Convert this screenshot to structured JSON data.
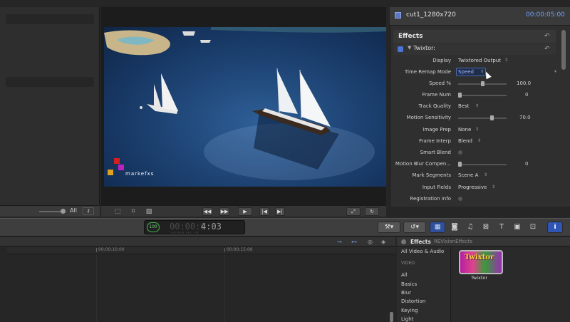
{
  "left_browser": {
    "filter_label": "All",
    "button_icon": "key-icon"
  },
  "viewer": {
    "logo_text": "markefxs",
    "footer_icons": [
      "crop-icon",
      "transform-icon",
      "distort-icon",
      "prev-frame-icon",
      "next-frame-icon",
      "play-icon",
      "to-start-icon",
      "to-end-icon",
      "fullscreen-icon",
      "loop-icon"
    ]
  },
  "inspector": {
    "clip_name": "cut1_1280x720",
    "timecode": "00:00:05:00",
    "section_title": "Effects",
    "effect_name": "Twixtor:",
    "params": [
      {
        "label": "Display",
        "value": "Twixtored Output"
      },
      {
        "label": "Time Remap Mode",
        "value": "Speed"
      },
      {
        "label": "Speed %",
        "number": "100.0",
        "level": 0.5
      },
      {
        "label": "Frame Num",
        "number": "0",
        "level": 0.0
      },
      {
        "label": "Track Quality",
        "value": "Best"
      },
      {
        "label": "Motion Sensitivity",
        "number": "70.0",
        "level": 0.7
      },
      {
        "label": "Image Prep",
        "value": "None"
      },
      {
        "label": "Frame Interp",
        "value": "Blend"
      },
      {
        "label": "Smart Blend",
        "checkbox": true
      },
      {
        "label": "Motion Blur Compen...",
        "number": "0",
        "level": 0.0
      },
      {
        "label": "Mark Segments",
        "value": "Scene A"
      },
      {
        "label": "Input Fields",
        "value": "Progressive"
      },
      {
        "label": "Registration info",
        "checkbox": true
      }
    ]
  },
  "toolbar": {
    "tc_badge": "100",
    "tc_dim": "00:00:0",
    "tc_lit": "4:03",
    "tc_units": "HR MIN SEC FR"
  },
  "timeline": {
    "ruler_labels": [
      "00:00:10:00",
      "00:00:15:00"
    ]
  },
  "effects_browser": {
    "title": "Effects",
    "vendor": "REVisionEffects",
    "top_item": "All Video & Audio",
    "section": "VIDEO",
    "categories": [
      "All",
      "Basics",
      "Blur",
      "Distortion",
      "Keying",
      "Light"
    ],
    "thumb_title": "Twixtor",
    "thumb_label": "Twixtor"
  }
}
